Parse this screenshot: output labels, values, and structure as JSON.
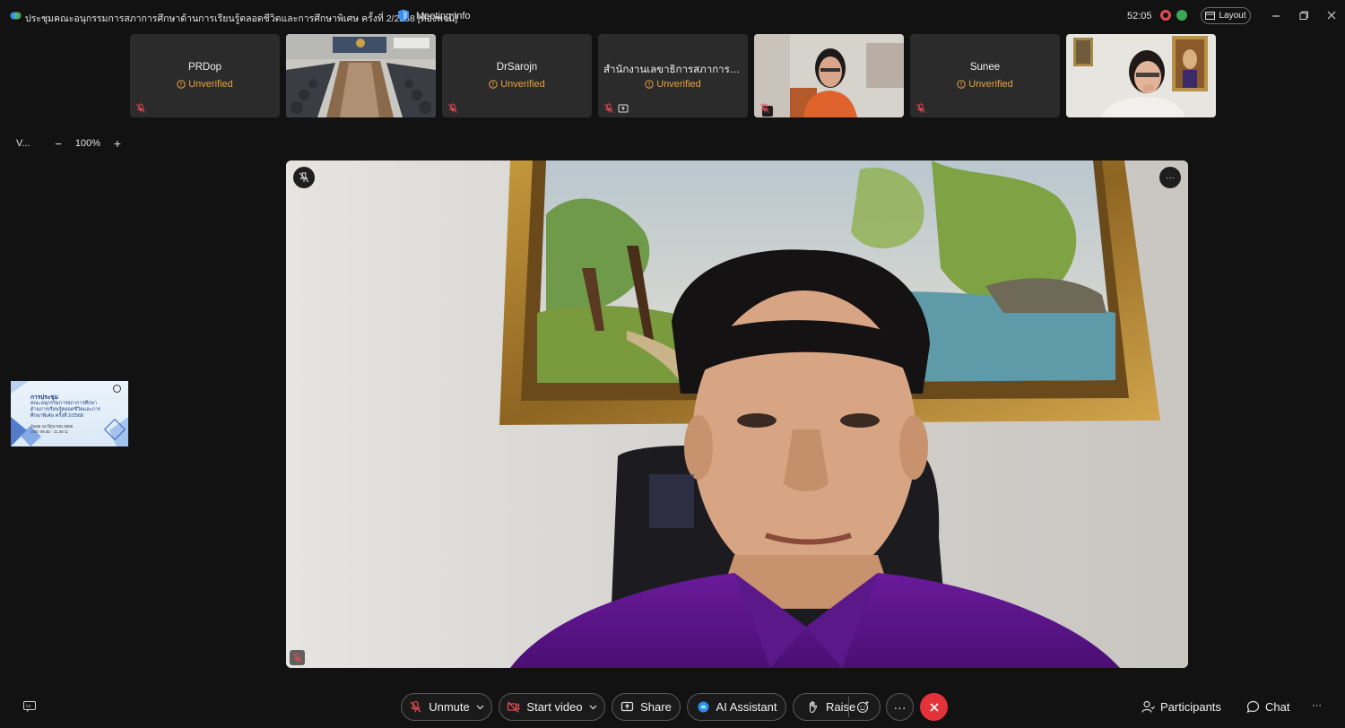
{
  "window": {
    "title": "ประชุมคณะอนุกรรมการสภาการศึกษาด้านการเรียนรู้ตลอดชีวิตและการศึกษาพิเศษ ครั้งที่ 2/2568 [ห้องพจนี]",
    "meeting_info_label": "Meeting Info",
    "timer": "52:05",
    "layout_label": "Layout"
  },
  "participants_strip": [
    {
      "name": "PRDop",
      "status": "Unverified"
    },
    {
      "name": "",
      "status": ""
    },
    {
      "name": "DrSarojn",
      "status": "Unverified"
    },
    {
      "name": "สำนักงานเลขาธิการสภาการศึก...",
      "status": "Unverified"
    },
    {
      "name": "",
      "status": ""
    },
    {
      "name": "Sunee",
      "status": "Unverified"
    },
    {
      "name": "",
      "status": ""
    }
  ],
  "zoom": {
    "view_label": "V...",
    "level": "100%",
    "minus": "−",
    "plus": "+"
  },
  "side_slide": {
    "lines": [
      "การประชุม",
      "คณะอนุกรรมการสภาการศึกษา",
      "ด้านการเรียนรู้ตลอดชีวิตและการ",
      "ศึกษาพิเศษ ครั้งที่ 2/2568",
      "วันพุธ 18 มิถุนายน 2568",
      "เวลา 09.30 - 11.30 น."
    ]
  },
  "toolbar": {
    "unmute": "Unmute",
    "start_video": "Start video",
    "share": "Share",
    "ai_assistant": "AI Assistant",
    "raise": "Raise",
    "more": "···",
    "participants": "Participants",
    "chat": "Chat",
    "overflow": "···"
  },
  "colors": {
    "background": "#121212",
    "tile": "#2b2b2b",
    "unverified": "#e6a23c",
    "end_call": "#e2323a",
    "mic_muted": "#e24a52"
  }
}
